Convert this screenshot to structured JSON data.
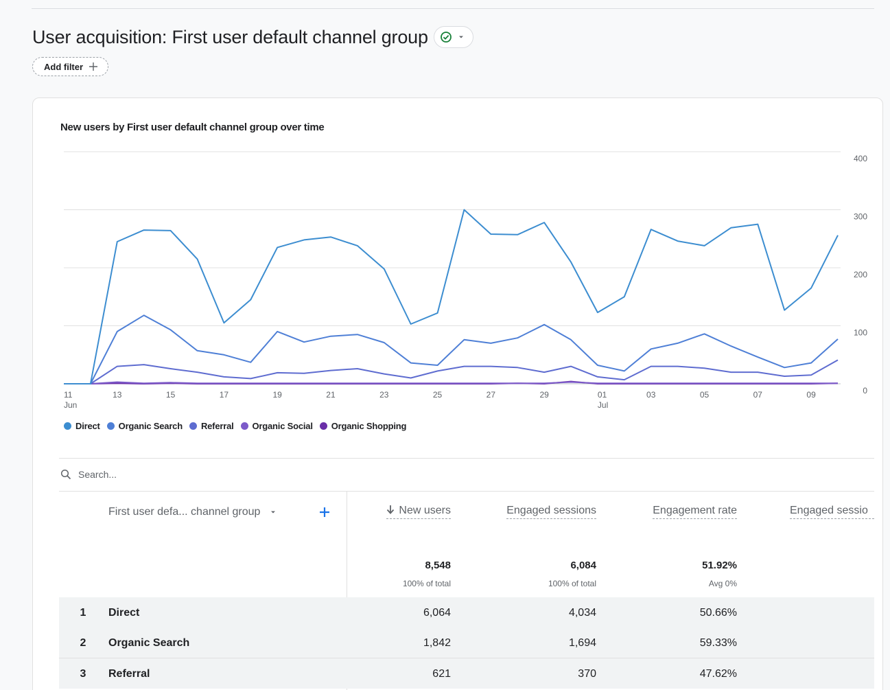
{
  "header": {
    "title": "User acquisition: First user default channel group",
    "add_filter_label": "Add filter"
  },
  "colors": {
    "Direct": "#3c8dd0",
    "Organic Search": "#4e7fd6",
    "Referral": "#5e6cd0",
    "Organic Social": "#7c5bc9",
    "Organic Shopping": "#6a2fa8",
    "status_check": "#188038"
  },
  "chart_data": {
    "type": "line",
    "title": "New users by First user default channel group over time",
    "x": [
      "11 Jun",
      "12",
      "13",
      "14",
      "15",
      "16",
      "17",
      "18",
      "19",
      "20",
      "21",
      "22",
      "23",
      "24",
      "25",
      "26",
      "27",
      "28",
      "29",
      "30",
      "01 Jul",
      "02",
      "03",
      "04",
      "05",
      "06",
      "07",
      "08",
      "09",
      "10"
    ],
    "x_tick_labels": [
      {
        "index": 0,
        "line1": "11",
        "line2": "Jun"
      },
      {
        "index": 2,
        "line1": "13",
        "line2": ""
      },
      {
        "index": 4,
        "line1": "15",
        "line2": ""
      },
      {
        "index": 6,
        "line1": "17",
        "line2": ""
      },
      {
        "index": 8,
        "line1": "19",
        "line2": ""
      },
      {
        "index": 10,
        "line1": "21",
        "line2": ""
      },
      {
        "index": 12,
        "line1": "23",
        "line2": ""
      },
      {
        "index": 14,
        "line1": "25",
        "line2": ""
      },
      {
        "index": 16,
        "line1": "27",
        "line2": ""
      },
      {
        "index": 18,
        "line1": "29",
        "line2": ""
      },
      {
        "index": 20,
        "line1": "01",
        "line2": "Jul"
      },
      {
        "index": 22,
        "line1": "03",
        "line2": ""
      },
      {
        "index": 24,
        "line1": "05",
        "line2": ""
      },
      {
        "index": 26,
        "line1": "07",
        "line2": ""
      },
      {
        "index": 28,
        "line1": "09",
        "line2": ""
      }
    ],
    "y_ticks": [
      0,
      100,
      200,
      300,
      400
    ],
    "ylim": [
      0,
      400
    ],
    "y_axis_side": "right",
    "grid": true,
    "legend_position": "bottom-left",
    "series": [
      {
        "name": "Direct",
        "values": [
          0,
          0,
          245,
          265,
          264,
          215,
          105,
          145,
          235,
          248,
          253,
          238,
          198,
          103,
          122,
          300,
          258,
          257,
          278,
          210,
          123,
          150,
          266,
          246,
          238,
          269,
          275,
          127,
          165,
          256
        ]
      },
      {
        "name": "Organic Search",
        "values": [
          0,
          0,
          90,
          118,
          93,
          57,
          50,
          37,
          90,
          72,
          82,
          85,
          71,
          36,
          32,
          76,
          70,
          79,
          102,
          76,
          32,
          22,
          60,
          70,
          86,
          65,
          46,
          28,
          36,
          77
        ]
      },
      {
        "name": "Referral",
        "values": [
          0,
          0,
          30,
          33,
          26,
          20,
          12,
          9,
          19,
          18,
          23,
          26,
          17,
          10,
          22,
          30,
          30,
          28,
          20,
          30,
          12,
          7,
          30,
          30,
          27,
          20,
          20,
          13,
          15,
          41
        ]
      },
      {
        "name": "Organic Social",
        "values": [
          0,
          0,
          3,
          1,
          2,
          1,
          1,
          1,
          1,
          1,
          1,
          1,
          1,
          1,
          1,
          1,
          1,
          1,
          1,
          3,
          1,
          1,
          1,
          1,
          1,
          1,
          1,
          1,
          1,
          1
        ]
      },
      {
        "name": "Organic Shopping",
        "values": [
          0,
          0,
          1,
          0,
          1,
          0,
          0,
          0,
          0,
          0,
          0,
          0,
          0,
          0,
          0,
          0,
          0,
          1,
          0,
          4,
          0,
          0,
          0,
          0,
          0,
          0,
          0,
          0,
          0,
          1
        ]
      }
    ]
  },
  "search": {
    "placeholder": "Search..."
  },
  "table": {
    "dimension_header": "First user defa... channel group",
    "columns": [
      "New users",
      "Engaged sessions",
      "Engagement rate",
      "Engaged sessio"
    ],
    "totals": [
      {
        "value": "8,548",
        "sub": "100% of total"
      },
      {
        "value": "6,084",
        "sub": "100% of total"
      },
      {
        "value": "51.92%",
        "sub": "Avg 0%"
      }
    ],
    "rows": [
      {
        "index": "1",
        "name": "Direct",
        "new_users": "6,064",
        "engaged_sessions": "4,034",
        "engagement_rate": "50.66%"
      },
      {
        "index": "2",
        "name": "Organic Search",
        "new_users": "1,842",
        "engaged_sessions": "1,694",
        "engagement_rate": "59.33%"
      },
      {
        "index": "3",
        "name": "Referral",
        "new_users": "621",
        "engaged_sessions": "370",
        "engagement_rate": "47.62%"
      }
    ]
  }
}
